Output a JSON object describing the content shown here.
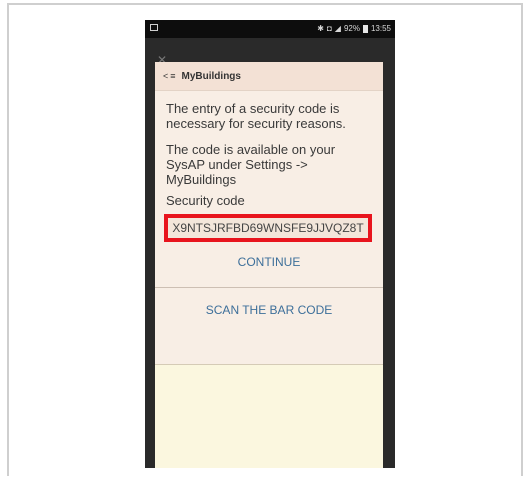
{
  "status_bar": {
    "battery": "92%",
    "time": "13:55"
  },
  "dialog": {
    "back_glyph": "<",
    "menu_glyph": "≡",
    "title": "MyBuildings",
    "paragraph1": "The entry of a security code is necessary for security reasons.",
    "paragraph2": "The code is available on your SysAP under Settings -> MyBuildings",
    "code_label": "Security code",
    "code_value": "X9NTSJRFBD69WNSFE9JJVQZ8T",
    "continue_label": "CONTINUE",
    "scan_label": "SCAN THE BAR CODE"
  },
  "colors": {
    "highlight": "#e8141d",
    "link": "#3d6f9a",
    "dialog_bg": "#f8eee5"
  }
}
